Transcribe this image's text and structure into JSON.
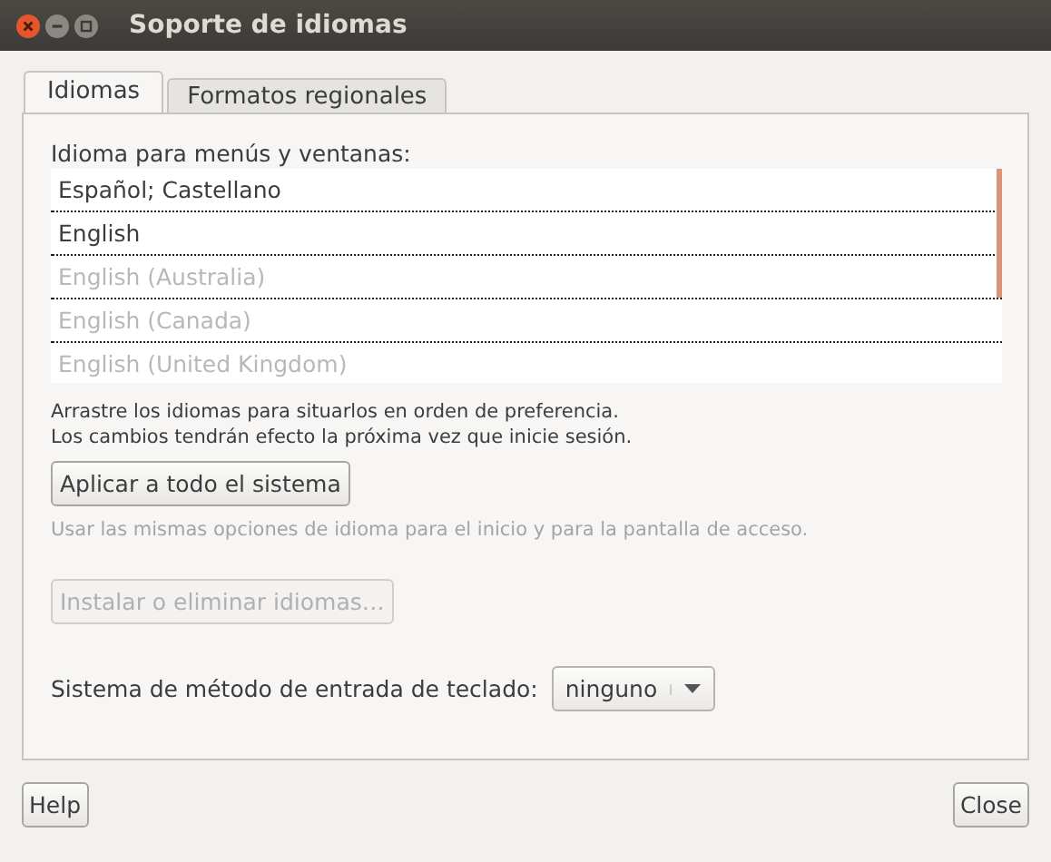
{
  "window": {
    "title": "Soporte de idiomas"
  },
  "tabs": [
    {
      "label": "Idiomas",
      "selected": true
    },
    {
      "label": "Formatos regionales",
      "selected": false
    }
  ],
  "language_list": {
    "label": "Idioma para menús y ventanas:",
    "items": [
      {
        "name": "Español; Castellano",
        "disabled": false
      },
      {
        "name": "English",
        "disabled": false
      },
      {
        "name": "English (Australia)",
        "disabled": true
      },
      {
        "name": "English (Canada)",
        "disabled": true
      },
      {
        "name": "English (United Kingdom)",
        "disabled": true
      }
    ]
  },
  "notes": [
    "Arrastre los idiomas para situarlos en orden de preferencia.",
    "Los cambios tendrán efecto la próxima vez que inicie sesión."
  ],
  "apply_button": {
    "label": "Aplicar a todo el sistema",
    "disabled": false
  },
  "apply_hint": "Usar las mismas opciones de idioma para el inicio y para la pantalla de acceso.",
  "install_button": {
    "label": "Instalar o eliminar idiomas…",
    "disabled": true
  },
  "keyboard": {
    "label": "Sistema de método de entrada de teclado:",
    "value": "ninguno"
  },
  "footer_buttons": [
    "Help",
    "Close"
  ]
}
